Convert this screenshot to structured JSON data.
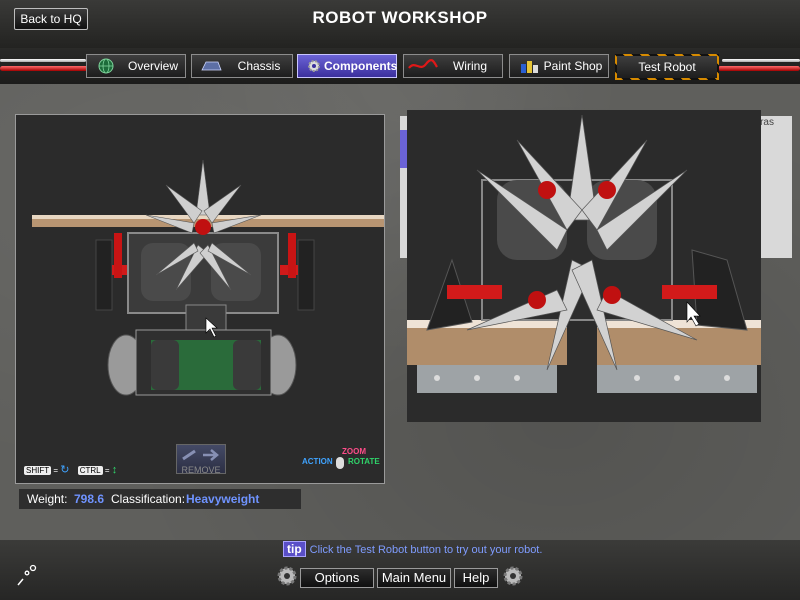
{
  "header": {
    "back_label": "Back to HQ",
    "title": "ROBOT WORKSHOP"
  },
  "tabs": [
    {
      "label": "Overview",
      "icon": "globe-icon"
    },
    {
      "label": "Chassis",
      "icon": "chassis-icon"
    },
    {
      "label": "Components",
      "icon": "gear-icon",
      "active": true
    },
    {
      "label": "Wiring",
      "icon": "wire-icon"
    },
    {
      "label": "Paint Shop",
      "icon": "paint-cans-icon"
    },
    {
      "label": "Test Robot",
      "icon": ""
    }
  ],
  "viewport": {
    "remove_label": "REMOVE",
    "key_shift": "SHIFT",
    "key_ctrl": "CTRL",
    "eq": "=",
    "action_label": "ACTION",
    "zoom_label": "ZOOM",
    "rotate_label": "ROTATE"
  },
  "stats": {
    "weight_label": "Weight:",
    "weight_value": "798.6",
    "class_label": "Classification:",
    "class_value": "Heavyweight"
  },
  "right_panel": {
    "partial_label": "ras"
  },
  "tip": {
    "badge": "tip",
    "text": "Click the Test Robot button to try out your robot."
  },
  "footer": {
    "options": "Options",
    "main_menu": "Main Menu",
    "help": "Help"
  },
  "colors": {
    "accent_active": "#5b52c9",
    "value_blue": "#6f93ff",
    "cable_red": "#c00000"
  }
}
